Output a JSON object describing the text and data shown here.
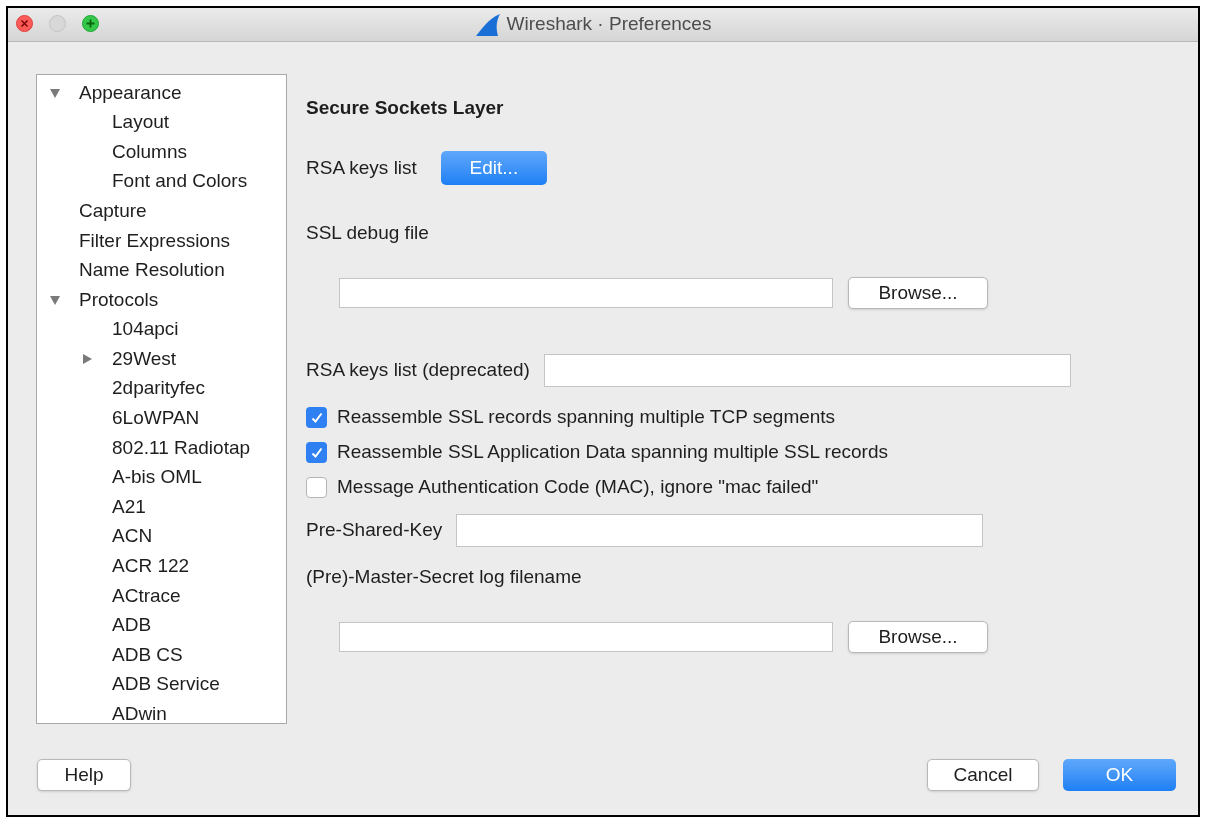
{
  "window": {
    "title": "Wireshark · Preferences"
  },
  "tree": [
    {
      "label": "Appearance",
      "expanded": true,
      "children": [
        {
          "label": "Layout"
        },
        {
          "label": "Columns"
        },
        {
          "label": "Font and Colors"
        }
      ]
    },
    {
      "label": "Capture"
    },
    {
      "label": "Filter Expressions"
    },
    {
      "label": "Name Resolution"
    },
    {
      "label": "Protocols",
      "expanded": true,
      "children": [
        {
          "label": "104apci"
        },
        {
          "label": "29West",
          "expanded": false
        },
        {
          "label": "2dparityfec"
        },
        {
          "label": "6LoWPAN"
        },
        {
          "label": "802.11 Radiotap"
        },
        {
          "label": "A-bis OML"
        },
        {
          "label": "A21"
        },
        {
          "label": "ACN"
        },
        {
          "label": "ACR 122"
        },
        {
          "label": "ACtrace"
        },
        {
          "label": "ADB"
        },
        {
          "label": "ADB CS"
        },
        {
          "label": "ADB Service"
        },
        {
          "label": "ADwin"
        }
      ]
    }
  ],
  "form": [
    {
      "kind": "heading",
      "text": "Secure Sockets Layer"
    },
    {
      "kind": "button_row",
      "label": "RSA keys list",
      "button": "Edit..."
    },
    {
      "kind": "label",
      "text": "SSL debug file"
    },
    {
      "kind": "file_row",
      "button": "Browse..."
    },
    {
      "kind": "text_row",
      "label": "RSA keys list (deprecated)"
    },
    {
      "kind": "checkbox",
      "label": "Reassemble SSL records spanning multiple TCP segments",
      "checked": true
    },
    {
      "kind": "checkbox",
      "label": "Reassemble SSL Application Data spanning multiple SSL records",
      "checked": true
    },
    {
      "kind": "checkbox",
      "label": "Message Authentication Code (MAC), ignore \"mac failed\"",
      "checked": false
    },
    {
      "kind": "text_row",
      "label": "Pre-Shared-Key"
    },
    {
      "kind": "label",
      "text": "(Pre)-Master-Secret log filename"
    },
    {
      "kind": "file_row",
      "button": "Browse..."
    }
  ],
  "buttons": {
    "help": "Help",
    "cancel": "Cancel",
    "ok": "OK"
  }
}
